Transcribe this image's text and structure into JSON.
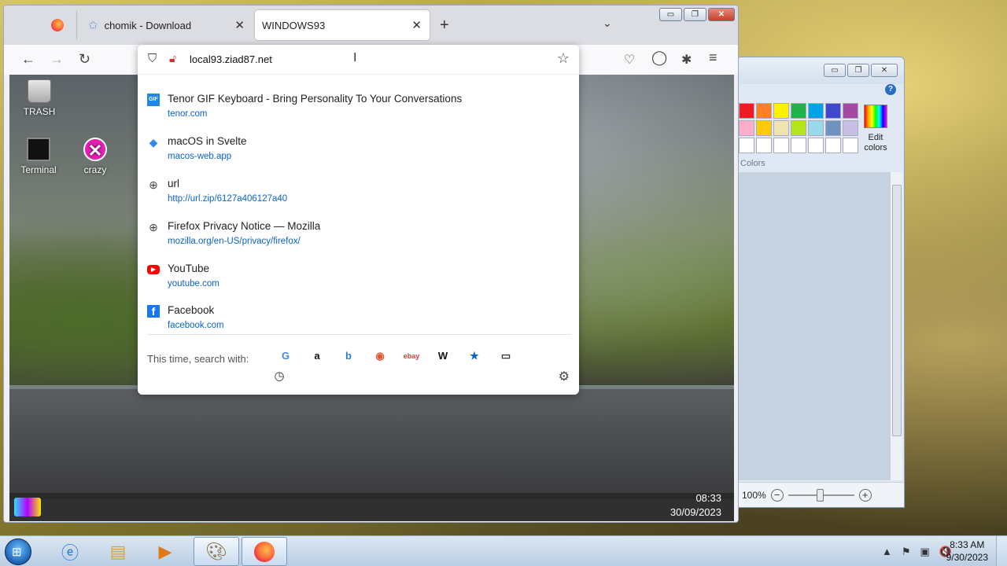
{
  "paint": {
    "window_buttons": [
      "▭",
      "❐",
      "✕"
    ],
    "help": "?",
    "palette_colors": [
      "#ed1c24",
      "#ff7f27",
      "#fff200",
      "#22b14c",
      "#00a2e8",
      "#3f48cc",
      "#a349a4",
      "#ffaec9",
      "#ffc90e",
      "#efe4b0",
      "#b5e61d",
      "#99d9ea",
      "#7092be",
      "#c8bfe7",
      "#ffffff",
      "#ffffff",
      "#ffffff",
      "#ffffff",
      "#ffffff",
      "#ffffff",
      "#ffffff"
    ],
    "edit_colors_label": "Edit colors",
    "colors_label": "Colors",
    "zoom_label": "100%",
    "zoom_minus": "−",
    "zoom_plus": "+"
  },
  "browser": {
    "window_buttons": [
      "▭",
      "❐",
      "✕"
    ],
    "tabs": [
      {
        "label": "",
        "icon": "firefox-icon"
      },
      {
        "label": "chomik - Download",
        "icon": "star-icon"
      },
      {
        "label": "WINDOWS93",
        "icon": ""
      }
    ],
    "tab_close": "✕",
    "new_tab": "+",
    "list_tabs": "⌄",
    "url_value": "local93.ziad87.net",
    "suggestions": [
      {
        "title": "Tenor GIF Keyboard - Bring Personality To Your Conversations",
        "url": "tenor.com",
        "icon": "GIF",
        "icon_color": "#1e88e5"
      },
      {
        "title": "macOS in Svelte",
        "url": "macos-web.app",
        "icon": "◆",
        "icon_color": "#2d8cf0"
      },
      {
        "title": "url",
        "url": "http://url.zip/6127a406127a40",
        "icon": "⊕",
        "icon_color": "#444444"
      },
      {
        "title": "Firefox Privacy Notice — Mozilla",
        "url": "mozilla.org/en-US/privacy/firefox/",
        "icon": "⊕",
        "icon_color": "#444444"
      },
      {
        "title": "YouTube",
        "url": "youtube.com",
        "icon": "▶",
        "icon_color": "#ff0000"
      },
      {
        "title": "Facebook",
        "url": "facebook.com",
        "icon": "f",
        "icon_color": "#1877f2"
      }
    ],
    "search_with_label": "This time, search with:",
    "engines": [
      {
        "name": "google",
        "glyph": "G",
        "color": "#4285f4"
      },
      {
        "name": "amazon",
        "glyph": "a",
        "color": "#111111"
      },
      {
        "name": "bing",
        "glyph": "b",
        "color": "#2b7bd6"
      },
      {
        "name": "duckduckgo",
        "glyph": "◉",
        "color": "#de5833"
      },
      {
        "name": "ebay",
        "glyph": "ebay",
        "color": "#e53238"
      },
      {
        "name": "wikipedia",
        "glyph": "W",
        "color": "#111111"
      },
      {
        "name": "bookmarks",
        "glyph": "★",
        "color": "#0b63c5"
      },
      {
        "name": "tabs",
        "glyph": "▭",
        "color": "#333333"
      }
    ],
    "history_glyph": "◷",
    "settings_glyph": "⚙"
  },
  "desktop93": {
    "icons": [
      {
        "label": "TRASH"
      },
      {
        "label": "Terminal"
      },
      {
        "label": "crazy"
      }
    ],
    "crazy_glyph": "✕",
    "time": "08:33",
    "date": "30/09/2023"
  },
  "taskbar": {
    "time": "8:33 AM",
    "date": "9/30/2023",
    "tray_glyphs": [
      "▲",
      "⚑",
      "▣",
      "🔇"
    ]
  }
}
